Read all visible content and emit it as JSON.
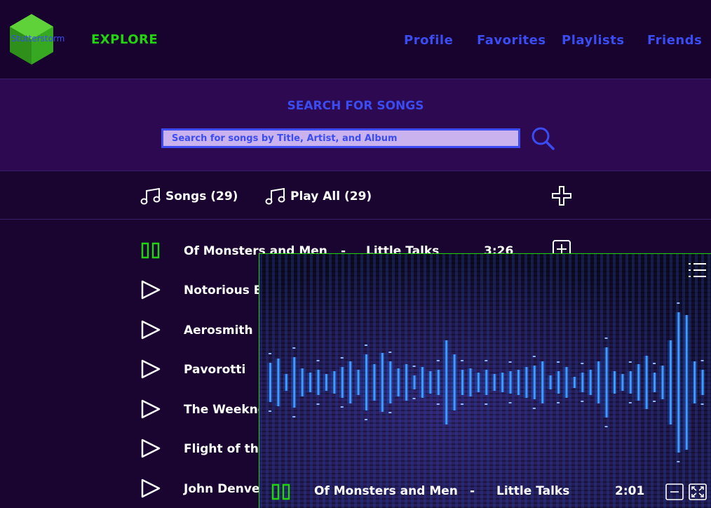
{
  "brand": {
    "name": "Stutterstorm",
    "explore_label": "EXPLORE"
  },
  "nav": {
    "items": [
      "Profile",
      "Favorites",
      "Playlists",
      "Friends"
    ]
  },
  "search": {
    "title": "SEARCH FOR SONGS",
    "placeholder": "Search for songs by Title, Artist, and Album"
  },
  "toolbar": {
    "songs_label": "Songs (29)",
    "play_all_label": "Play All (29)"
  },
  "songs": [
    {
      "artist": "Of Monsters and Men",
      "dash": "-",
      "title": "Little Talks",
      "duration": "3:26",
      "state": "playing"
    },
    {
      "artist": "Notorious B",
      "state": "stopped"
    },
    {
      "artist": "Aerosmith",
      "state": "stopped"
    },
    {
      "artist": "Pavorotti",
      "state": "stopped"
    },
    {
      "artist": "The Weeknd",
      "state": "stopped"
    },
    {
      "artist": "Flight of the",
      "state": "stopped"
    },
    {
      "artist": "John Denve",
      "state": "stopped"
    }
  ],
  "player": {
    "artist": "Of Monsters and Men",
    "dash": "-",
    "title": "Little Talks",
    "time": "2:01"
  },
  "colors": {
    "accent_blue": "#3a4cf2",
    "accent_green": "#22d40f",
    "bg": "#1a0530"
  }
}
